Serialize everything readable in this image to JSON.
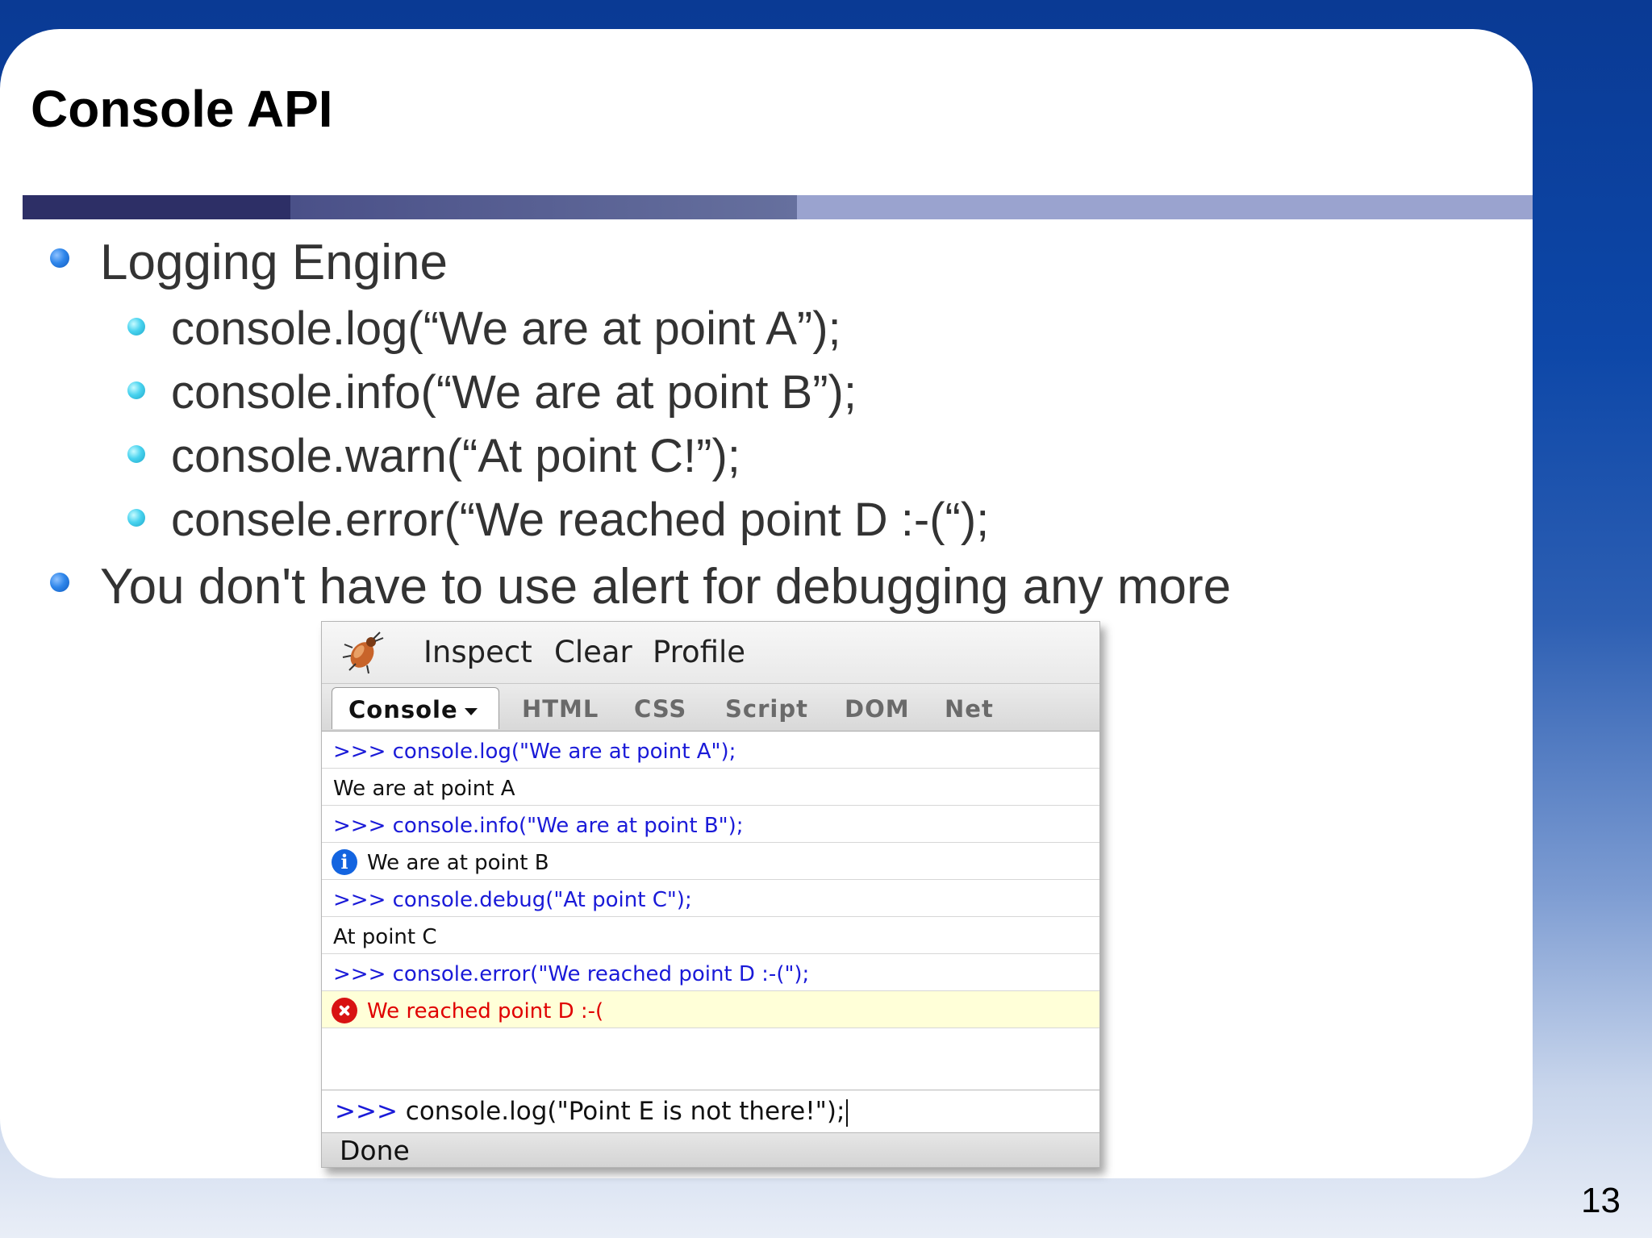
{
  "slide": {
    "title": "Console API",
    "page_number": "13",
    "bullets": [
      {
        "text": "Logging Engine",
        "sub": [
          "console.log(“We are at point A”);",
          "console.info(“We are at point B”);",
          "console.warn(“At point C!”);",
          "consele.error(“We reached point D :-(“);"
        ]
      },
      {
        "text": "You don't have to use alert for debugging any more"
      }
    ],
    "colors": {
      "background_top": "#0a3a94",
      "bullet_primary": "#2f86ea",
      "bullet_secondary": "#49d3ef"
    }
  },
  "firebug": {
    "icon": "firebug-bug-icon",
    "toolbar": [
      "Inspect",
      "Clear",
      "Profile"
    ],
    "tabs": [
      {
        "label": "Console",
        "active": true
      },
      {
        "label": "HTML"
      },
      {
        "label": "CSS"
      },
      {
        "label": "Script"
      },
      {
        "label": "DOM"
      },
      {
        "label": "Net"
      }
    ],
    "rows": [
      {
        "type": "command",
        "text": ">>> console.log(\"We are at point A\");"
      },
      {
        "type": "output",
        "text": "We are at point A"
      },
      {
        "type": "command",
        "text": ">>> console.info(\"We are at point B\");"
      },
      {
        "type": "info",
        "icon": "info-icon",
        "text": "We are at point B"
      },
      {
        "type": "command",
        "text": ">>> console.debug(\"At point C\");"
      },
      {
        "type": "output",
        "text": "At point C"
      },
      {
        "type": "command",
        "text": ">>> console.error(\"We reached point D :-(\");"
      },
      {
        "type": "error",
        "icon": "error-icon",
        "text": "We reached point D :-("
      }
    ],
    "command_line": {
      "prompt": ">>>",
      "value": "console.log(\"Point E is not there!\");"
    },
    "status": "Done",
    "colors": {
      "command": "#1a1ad8",
      "error": "#e00000",
      "error_background": "#ffffd8"
    }
  }
}
